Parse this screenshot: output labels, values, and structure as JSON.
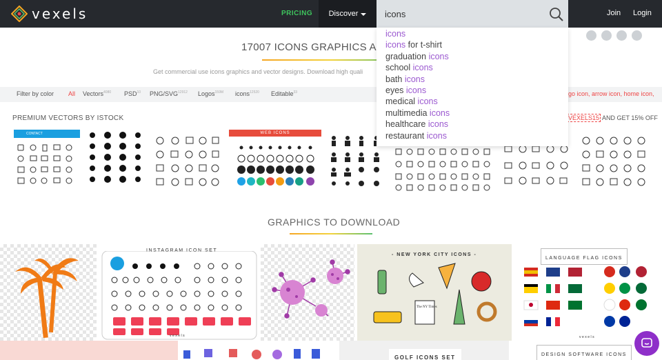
{
  "nav": {
    "logo_text": "vexels",
    "pricing": "PRICING",
    "discover": "Discover",
    "join": "Join",
    "login": "Login"
  },
  "search": {
    "value": "icons",
    "suggestions": [
      {
        "prefix": "",
        "highlight": "icons",
        "suffix": ""
      },
      {
        "prefix": "",
        "highlight": "icons",
        "suffix": " for t-shirt"
      },
      {
        "prefix": "graduation ",
        "highlight": "icons",
        "suffix": ""
      },
      {
        "prefix": "school ",
        "highlight": "icons",
        "suffix": ""
      },
      {
        "prefix": "bath ",
        "highlight": "icons",
        "suffix": ""
      },
      {
        "prefix": "eyes ",
        "highlight": "icons",
        "suffix": ""
      },
      {
        "prefix": "medical ",
        "highlight": "icons",
        "suffix": ""
      },
      {
        "prefix": "multimedia ",
        "highlight": "icons",
        "suffix": ""
      },
      {
        "prefix": "healthcare ",
        "highlight": "icons",
        "suffix": ""
      },
      {
        "prefix": "restaurant ",
        "highlight": "icons",
        "suffix": ""
      }
    ]
  },
  "header": {
    "headline": "17007 ICONS GRAPHICS AND",
    "subline": "Get commercial use icons graphics and vector designs. Download high quali"
  },
  "filters": {
    "filter_by_color": "Filter by color",
    "all": "All",
    "vectors": "Vectors",
    "vectors_count": "4080",
    "psd": "PSD",
    "psd_count": "10",
    "png": "PNG/SVG",
    "png_count": "12912",
    "logos": "Logos",
    "logos_count": "159M",
    "icons": "icons",
    "icons_count": "12520",
    "editable": "Editable",
    "editable_count": "33",
    "tags": "go icon, arrow icon, home icon,"
  },
  "premium": {
    "title": "PREMIUM VECTORS BY ISTOCK",
    "coupon_code": "VEXELS15",
    "coupon_text": " AND GET 15% OFF",
    "thumb1_label": "CONTACT",
    "thumb3_label": "WEB ICONS"
  },
  "graphics": {
    "title": "GRAPHICS TO DOWNLOAD",
    "instagram_label": "INSTAGRAM ICON SET",
    "instagram_brand": "vexels",
    "nyc_label": "- NEW YORK CITY ICONS -",
    "nyc_brand": "vexels",
    "nyc_sign": "The NY Times",
    "nyc_taxi": "TAXI",
    "flag_label": "LANGUAGE FLAG ICONS",
    "flag_brand": "vexels",
    "golf_label": "GOLF ICONS SET",
    "design_label": "DESIGN SOFTWARE ICONS"
  },
  "colors": {
    "nav_bg": "#26292e",
    "pricing": "#3ec35d",
    "highlight": "#9b59d0",
    "accent_red": "#e44444",
    "chat": "#8e2fc9",
    "palm": "#f07b16"
  }
}
